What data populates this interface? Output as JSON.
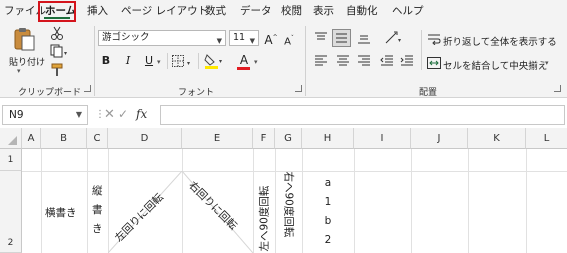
{
  "menu": {
    "tabs": [
      "ファイル",
      "ホーム",
      "挿入",
      "ページ レイアウト",
      "数式",
      "データ",
      "校閲",
      "表示",
      "自動化",
      "ヘルプ"
    ],
    "active_tab": "ホーム"
  },
  "ribbon": {
    "clipboard": {
      "label": "クリップボード",
      "paste_label": "貼り付け"
    },
    "font": {
      "label": "フォント",
      "font_name": "游ゴシック",
      "font_size": "11",
      "grow_label": "A",
      "shrink_label": "A",
      "bold": "B",
      "italic": "I",
      "underline": "U",
      "font_color_label": "A",
      "font_color": "#e11b22",
      "highlight_color": "#ffe800"
    },
    "alignment": {
      "label": "配置",
      "wrap_text": "折り返して全体を表示する",
      "merge_center": "セルを結合して中央揃え"
    }
  },
  "formula_bar": {
    "name_box": "N9",
    "fx": "fx",
    "value": ""
  },
  "grid": {
    "columns": [
      "A",
      "B",
      "C",
      "D",
      "E",
      "F",
      "G",
      "H",
      "I",
      "J",
      "K",
      "L"
    ],
    "rows": [
      "1",
      "2"
    ],
    "cells": {
      "B2": "横書き",
      "C2": "縦書き",
      "D2": "左回りに回転",
      "E2": "右回りに回転",
      "F2": "左へ90度回転",
      "G2": "右へ90度回転",
      "H2": [
        "a",
        "1",
        "b",
        "2"
      ]
    }
  },
  "colors": {
    "accent_green": "#1e6e3c",
    "highlight_red": "#d4141c"
  }
}
